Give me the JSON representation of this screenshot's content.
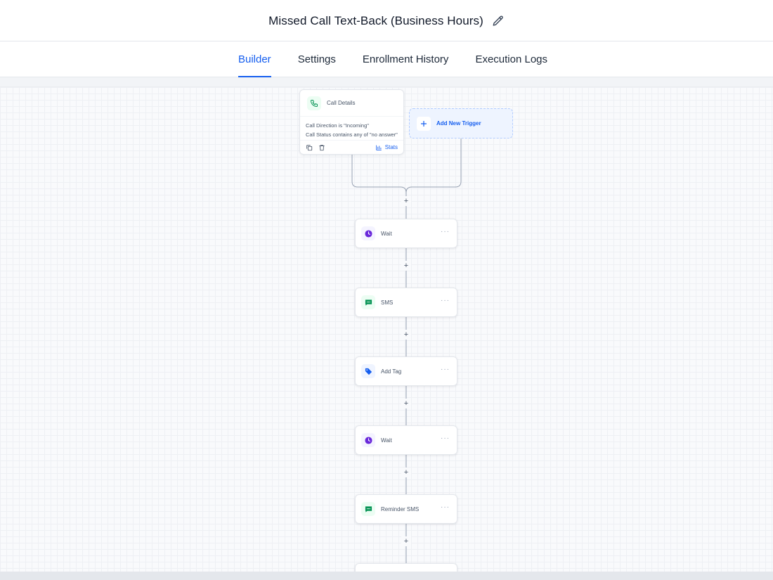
{
  "header": {
    "title": "Missed Call Text-Back (Business Hours)",
    "edit_icon": "pencil-icon"
  },
  "tabs": [
    {
      "label": "Builder",
      "active": true
    },
    {
      "label": "Settings",
      "active": false
    },
    {
      "label": "Enrollment History",
      "active": false
    },
    {
      "label": "Execution Logs",
      "active": false
    }
  ],
  "trigger": {
    "title": "Call Details",
    "icon": "phone-icon",
    "conditions": [
      "Call Direction is \"Incoming\"",
      "Call Status contains any of \"no answer\""
    ],
    "stats_label": "Stats"
  },
  "add_trigger": {
    "label": "Add New Trigger"
  },
  "plus_symbol": "+",
  "more_symbol": "···",
  "actions": [
    {
      "label": "Wait",
      "icon": "clock-icon",
      "color": "#6927da"
    },
    {
      "label": "SMS",
      "icon": "message-icon",
      "color": "#079455"
    },
    {
      "label": "Add Tag",
      "icon": "tag-icon",
      "color": "#155eef"
    },
    {
      "label": "Wait",
      "icon": "clock-icon",
      "color": "#6927da"
    },
    {
      "label": "Reminder SMS",
      "icon": "message-icon",
      "color": "#079455"
    }
  ],
  "colors": {
    "accent": "#155eef",
    "wait": "#6927da",
    "sms": "#079455",
    "tag": "#155eef"
  }
}
